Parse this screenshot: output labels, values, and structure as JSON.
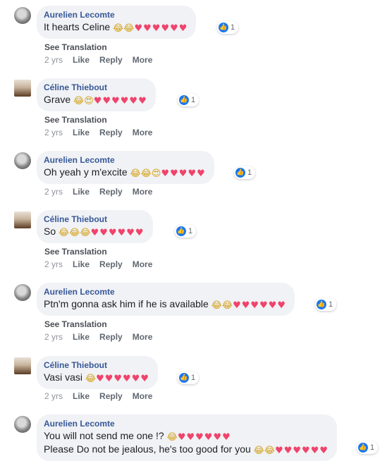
{
  "translation_label": "See Translation",
  "actions": {
    "like": "Like",
    "reply": "Reply",
    "more": "More"
  },
  "comments": [
    {
      "author": "Aurelien Lecomte",
      "text": "It hearts Celine",
      "age": "2 yrs",
      "reactions": "1",
      "see_translation": true
    },
    {
      "author": "Céline Thiebout",
      "text": "Grave",
      "age": "2 yrs",
      "reactions": "1",
      "see_translation": true
    },
    {
      "author": "Aurelien Lecomte",
      "text": "Oh yeah y m'excite",
      "age": "2 yrs",
      "reactions": "1",
      "see_translation": false
    },
    {
      "author": "Céline Thiebout",
      "text": "So",
      "age": "2 yrs",
      "reactions": "1",
      "see_translation": true
    },
    {
      "author": "Aurelien Lecomte",
      "text": "Ptn'm gonna ask him if he is available",
      "age": "2 yrs",
      "reactions": "1",
      "see_translation": true
    },
    {
      "author": "Céline Thiebout",
      "text": "Vasi vasi",
      "age": "2 yrs",
      "reactions": "1",
      "see_translation": false
    },
    {
      "author": "Aurelien Lecomte",
      "text": "You will not send me one !?",
      "text2": "Please Do not be jealous, he's too good for you",
      "reactions": "1"
    }
  ],
  "icons": {
    "laugh": "laughing-emoji",
    "heart": "red-heart-emoji",
    "love_eyes": "heart-eyes-emoji",
    "like": "thumbs-up-like-icon"
  },
  "colors": {
    "author": "#385898",
    "bubble": "#f0f2f5",
    "like_blue": "#1877f2",
    "heart": "#f0436b"
  }
}
